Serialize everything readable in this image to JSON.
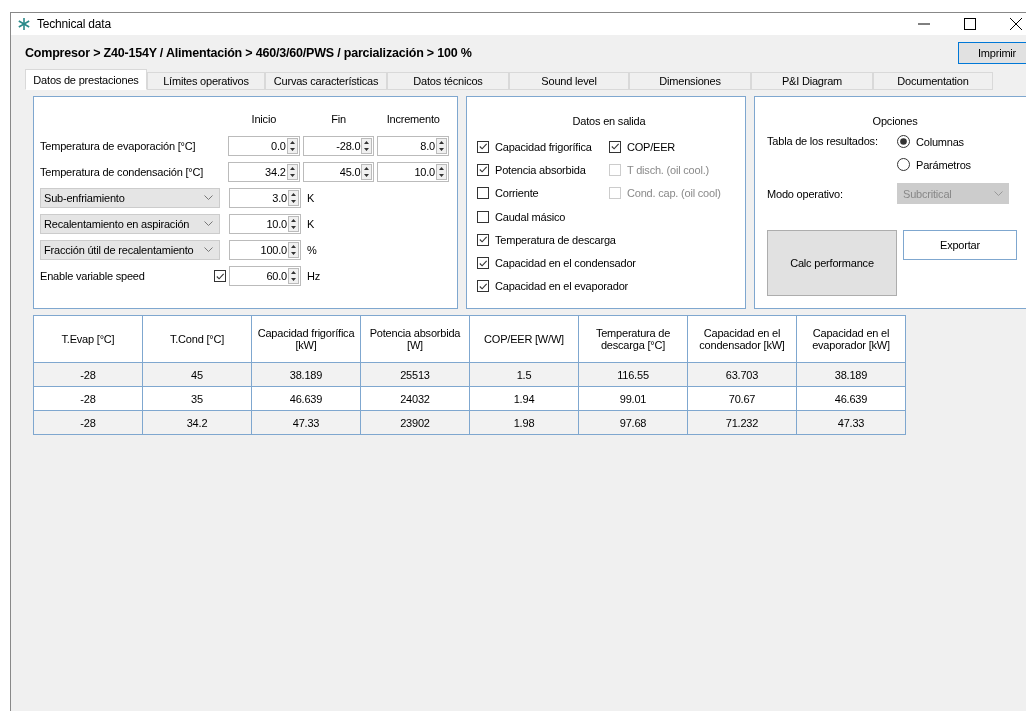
{
  "window": {
    "title": "Technical data"
  },
  "breadcrumb": "Compresor > Z40-154Y / Alimentación > 460/3/60/PWS / parcialización > 100 %",
  "print_button": "Imprimir",
  "tabs": [
    {
      "label": "Datos de prestaciones",
      "selected": true
    },
    {
      "label": "Límites operativos",
      "selected": false
    },
    {
      "label": "Curvas características",
      "selected": false
    },
    {
      "label": "Datos técnicos",
      "selected": false
    },
    {
      "label": "Sound level",
      "selected": false
    },
    {
      "label": "Dimensiones",
      "selected": false
    },
    {
      "label": "P&I Diagram",
      "selected": false
    },
    {
      "label": "Documentation",
      "selected": false
    }
  ],
  "input_panel": {
    "headers": [
      "Inicio",
      "Fin",
      "Incremento"
    ],
    "rows": [
      {
        "kind": "label",
        "label": "Temperatura de evaporación [°C]",
        "values": [
          "0.0",
          "-28.0",
          "8.0"
        ]
      },
      {
        "kind": "label",
        "label": "Temperatura de condensación [°C]",
        "values": [
          "34.2",
          "45.0",
          "10.0"
        ]
      },
      {
        "kind": "dropdown",
        "label": "Sub-enfriamiento",
        "values": [
          "3.0"
        ],
        "unit": "K"
      },
      {
        "kind": "dropdown",
        "label": "Recalentamiento en aspiración",
        "values": [
          "10.0"
        ],
        "unit": "K"
      },
      {
        "kind": "dropdown",
        "label": "Fracción útil de recalentamiento",
        "values": [
          "100.0"
        ],
        "unit": "%"
      },
      {
        "kind": "checkbox",
        "label": "Enable variable speed",
        "checked": true,
        "values": [
          "60.0"
        ],
        "unit": "Hz"
      }
    ]
  },
  "output_panel": {
    "title": "Datos en salida",
    "left_column": [
      {
        "label": "Capacidad frigorífica",
        "checked": true,
        "disabled": false
      },
      {
        "label": "Potencia absorbida",
        "checked": true,
        "disabled": false
      },
      {
        "label": "Corriente",
        "checked": false,
        "disabled": false
      },
      {
        "label": "Caudal másico",
        "checked": false,
        "disabled": false
      },
      {
        "label": "Temperatura de descarga",
        "checked": true,
        "disabled": false
      },
      {
        "label": "Capacidad en el condensador",
        "checked": true,
        "disabled": false
      },
      {
        "label": "Capacidad en el evaporador",
        "checked": true,
        "disabled": false
      }
    ],
    "right_column": [
      {
        "label": "COP/EER",
        "checked": true,
        "disabled": false
      },
      {
        "label": "T disch. (oil cool.)",
        "checked": false,
        "disabled": true
      },
      {
        "label": "Cond. cap. (oil cool)",
        "checked": false,
        "disabled": true
      }
    ]
  },
  "options_panel": {
    "title": "Opciones",
    "results_label": "Tabla de los resultados:",
    "radios": [
      {
        "label": "Columnas",
        "selected": true
      },
      {
        "label": "Parámetros",
        "selected": false
      }
    ],
    "mode_label": "Modo operativo:",
    "mode_value": "Subcritical",
    "mode_disabled": true,
    "calc_button": "Calc performance",
    "export_button": "Exportar"
  },
  "results": {
    "columns": [
      "T.Evap [°C]",
      "T.Cond [°C]",
      "Capacidad frigorífica [kW]",
      "Potencia absorbida [W]",
      "COP/EER [W/W]",
      "Temperatura de descarga [°C]",
      "Capacidad en el condensador [kW]",
      "Capacidad en el evaporador [kW]"
    ],
    "rows": [
      [
        "-28",
        "45",
        "38.189",
        "25513",
        "1.5",
        "116.55",
        "63.703",
        "38.189"
      ],
      [
        "-28",
        "35",
        "46.639",
        "24032",
        "1.94",
        "99.01",
        "70.67",
        "46.639"
      ],
      [
        "-28",
        "34.2",
        "47.33",
        "23902",
        "1.98",
        "97.68",
        "71.232",
        "47.33"
      ]
    ]
  }
}
